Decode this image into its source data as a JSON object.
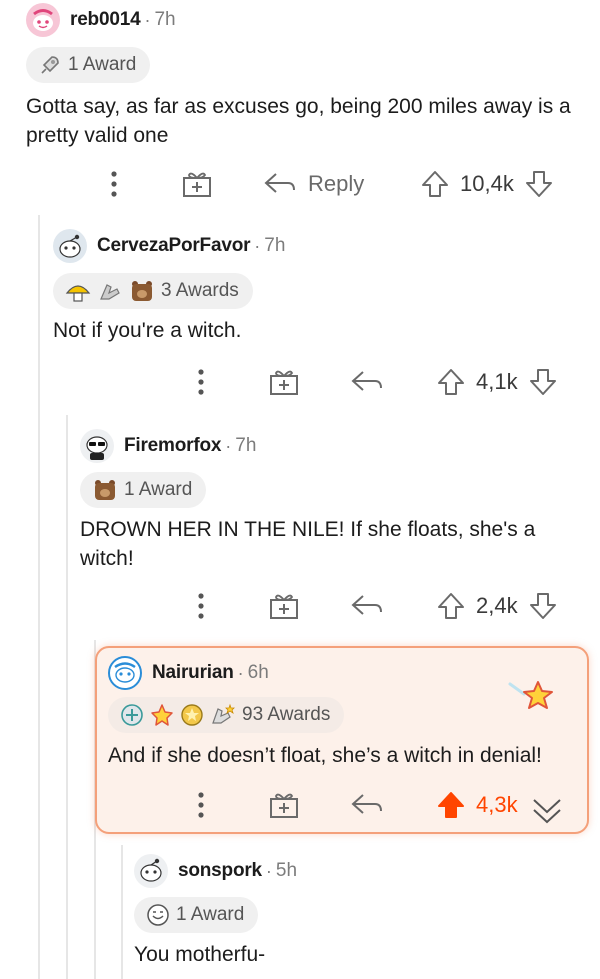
{
  "comments": [
    {
      "username": "reb0014",
      "time": "7h",
      "awards": "1 Award",
      "body": "Gotta say, as far as excuses go, being 200 miles away is a pretty valid one",
      "reply_label": "Reply",
      "votes": "10,4k"
    },
    {
      "username": "CervezaPorFavor",
      "time": "7h",
      "awards": "3 Awards",
      "body": "Not if you're a witch.",
      "votes": "4,1k"
    },
    {
      "username": "Firemorfox",
      "time": "7h",
      "awards": "1 Award",
      "body": "DROWN HER IN THE NILE! If she floats, she's a witch!",
      "votes": "2,4k"
    },
    {
      "username": "Nairurian",
      "time": "6h",
      "awards": "93 Awards",
      "body": "And if she doesn’t float, she’s a witch in denial!",
      "votes": "4,3k",
      "upvoted": true
    },
    {
      "username": "sonspork",
      "time": "5h",
      "awards": "1 Award",
      "body": "You motherfu-"
    }
  ],
  "meta": {
    "separator": "·",
    "accent": "#ff4500",
    "highlight_border": "#f4a07a"
  }
}
